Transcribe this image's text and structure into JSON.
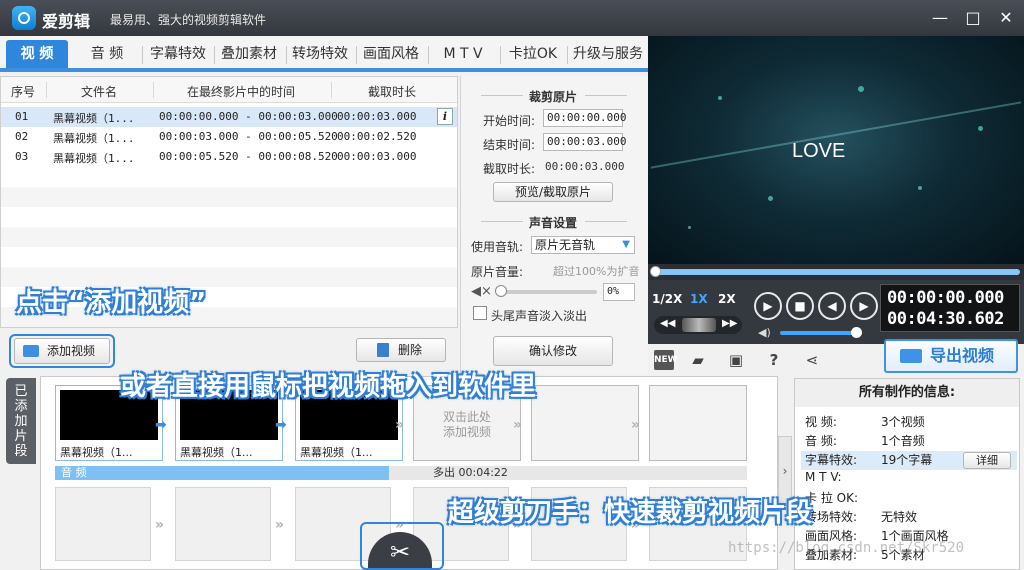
{
  "titlebar": {
    "app_name": "爱剪辑",
    "slogan": "最易用、强大的视频剪辑软件",
    "minimize": "—",
    "maximize": "□",
    "close": "✕"
  },
  "tabs": [
    {
      "label": "视  频",
      "active": true
    },
    {
      "label": "音  频"
    },
    {
      "label": "字幕特效"
    },
    {
      "label": "叠加素材"
    },
    {
      "label": "转场特效"
    },
    {
      "label": "画面风格"
    },
    {
      "label": "M T V"
    },
    {
      "label": "卡拉OK"
    },
    {
      "label": "升级与服务"
    }
  ],
  "video_list": {
    "headers": {
      "index": "序号",
      "filename": "文件名",
      "time_in_final": "在最终影片中的时间",
      "duration": "截取时长"
    },
    "rows": [
      {
        "index": "01",
        "filename": "黑幕视频（1...",
        "time_in_final": "00:00:00.000 - 00:00:03.000",
        "duration": "00:00:03.000"
      },
      {
        "index": "02",
        "filename": "黑幕视频（1...",
        "time_in_final": "00:00:03.000 - 00:00:05.520",
        "duration": "00:00:02.520"
      },
      {
        "index": "03",
        "filename": "黑幕视频（1...",
        "time_in_final": "00:00:05.520 - 00:00:08.520",
        "duration": "00:00:03.000"
      }
    ],
    "info_icon": "i",
    "add_video_button": "添加视频",
    "delete_button": "删除"
  },
  "trim": {
    "title": "裁剪原片",
    "start_label": "开始时间:",
    "start_value": "00:00:00.000",
    "end_label": "结束时间:",
    "end_value": "00:00:03.000",
    "duration_label": "截取时长:",
    "duration_value": "00:00:03.000",
    "preview_button": "预览/截取原片",
    "sound_title": "声音设置",
    "track_label": "使用音轨:",
    "track_value": "原片无音轨",
    "volume_label": "原片音量:",
    "volume_hint": "超过100%为扩音",
    "volume_value": "0%",
    "fade_label": "头尾声音淡入淡出",
    "confirm_button": "确认修改"
  },
  "preview": {
    "text": "LOVE",
    "speed_half": "1/2X",
    "speed_1x": "1X",
    "speed_2x": "2X",
    "current_time": "00:00:00.000",
    "total_time": "00:04:30.602",
    "export_button": "导出视频",
    "new_badge": "NEW"
  },
  "timeline": {
    "side_tab": "已添加片段",
    "clips": [
      {
        "caption": "黑幕视频（1..."
      },
      {
        "caption": "黑幕视频（1..."
      },
      {
        "caption": "黑幕视频（1..."
      }
    ],
    "add_hint": "双击此处\n添加视频",
    "audio_label": "音 频",
    "audio_extra": "多出 00:04:22",
    "collapse": "›"
  },
  "info": {
    "title": "所有制作的信息:",
    "rows": [
      {
        "k": "视    频:",
        "v": "3个视频"
      },
      {
        "k": "音    频:",
        "v": "1个音频"
      },
      {
        "k": "字幕特效:",
        "v": "19个字幕"
      },
      {
        "k": "M   T   V:",
        "v": ""
      },
      {
        "k": "卡 拉 OK:",
        "v": ""
      },
      {
        "k": "转场特效:",
        "v": "无特效"
      },
      {
        "k": "画面风格:",
        "v": "1个画面风格"
      },
      {
        "k": "叠加素材:",
        "v": "5个素材"
      }
    ],
    "detail_button": "详细"
  },
  "overlays": {
    "click_add": "点击“添加视频”",
    "drag_hint": "或者直接用鼠标把视频拖入到软件里",
    "scissors_hint": "超级剪刀手：快速裁剪视频片段"
  },
  "watermark": "https://blog.csdn.net/Skr520",
  "colors": {
    "accent": "#2f86dd",
    "overlay_outline": "#2f7fd6",
    "audio_fill": "#7ec0f3"
  }
}
